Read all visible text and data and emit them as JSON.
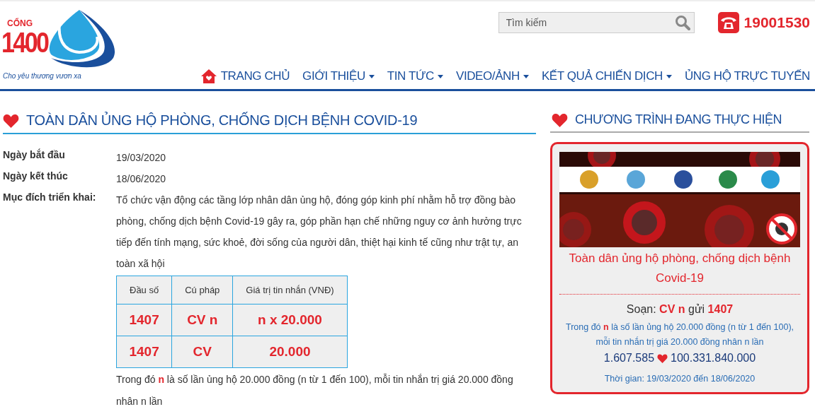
{
  "logo": {
    "title": "CỔNG",
    "number": "1400",
    "slogan": "Cho yêu thương vươn xa"
  },
  "search": {
    "placeholder": "Tìm kiếm"
  },
  "hotline": "19001530",
  "nav": [
    {
      "label": "TRANG CHỦ",
      "kind": "home"
    },
    {
      "label": "GIỚI THIỆU",
      "kind": "dropdown"
    },
    {
      "label": "TIN TỨC",
      "kind": "dropdown"
    },
    {
      "label": "VIDEO/ẢNH",
      "kind": "dropdown"
    },
    {
      "label": "KẾT QUẢ CHIẾN DỊCH",
      "kind": "dropdown"
    },
    {
      "label": "ỦNG HỘ TRỰC TUYẾN",
      "kind": "plain"
    }
  ],
  "main": {
    "title": "TOÀN DÂN ỦNG HỘ PHÒNG, CHỐNG DỊCH BỆNH COVID-19",
    "fields": [
      {
        "label": "Ngày bắt đầu",
        "value": "19/03/2020"
      },
      {
        "label": "Ngày kết thúc",
        "value": "18/06/2020"
      },
      {
        "label": "Mục đích triển khai:",
        "value": "Tổ chức vận động các tầng lớp nhân dân ủng hộ, đóng góp kinh phí nhằm hỗ trợ đồng bào phòng, chống dịch bệnh Covid-19 gây ra, góp phần hạn chế những nguy cơ ảnh hưởng trực tiếp đến tính mạng, sức khoẻ, đời sống của người dân, thiệt hại kinh tế cũng như trật tự, an toàn xã hội"
      }
    ],
    "table": {
      "columns": [
        "Đầu số",
        "Cú pháp",
        "Giá trị tin nhắn (VNĐ)"
      ],
      "rows": [
        [
          "1407",
          "CV n",
          "n x 20.000"
        ],
        [
          "1407",
          "CV",
          "20.000"
        ]
      ]
    },
    "note": "Trong đó **n** là số lần ủng hộ 20.000 đồng (n từ 1 đến 100), mỗi tin nhắn trị giá 20.000 đồng nhân n lần"
  },
  "sidebar": {
    "title": "CHƯƠNG TRÌNH ĐANG THỰC HIỆN",
    "card": {
      "kind": "picture",
      "title": "Toàn dân ủng hộ phòng, chống dịch bệnh Covid-19",
      "syntax": "Soạn: **CV n** gửi **1407**",
      "note": "Trong đó **n** là số lần ủng hộ 20.000 đồng (n từ 1 đến 100), mỗi tin nhắn trị giá 20.000 đồng nhân n lần",
      "count": "1.607.585",
      "amount": "100.331.840.000",
      "period": "Thời gian: 19/03/2020 đến 18/06/2020"
    }
  }
}
